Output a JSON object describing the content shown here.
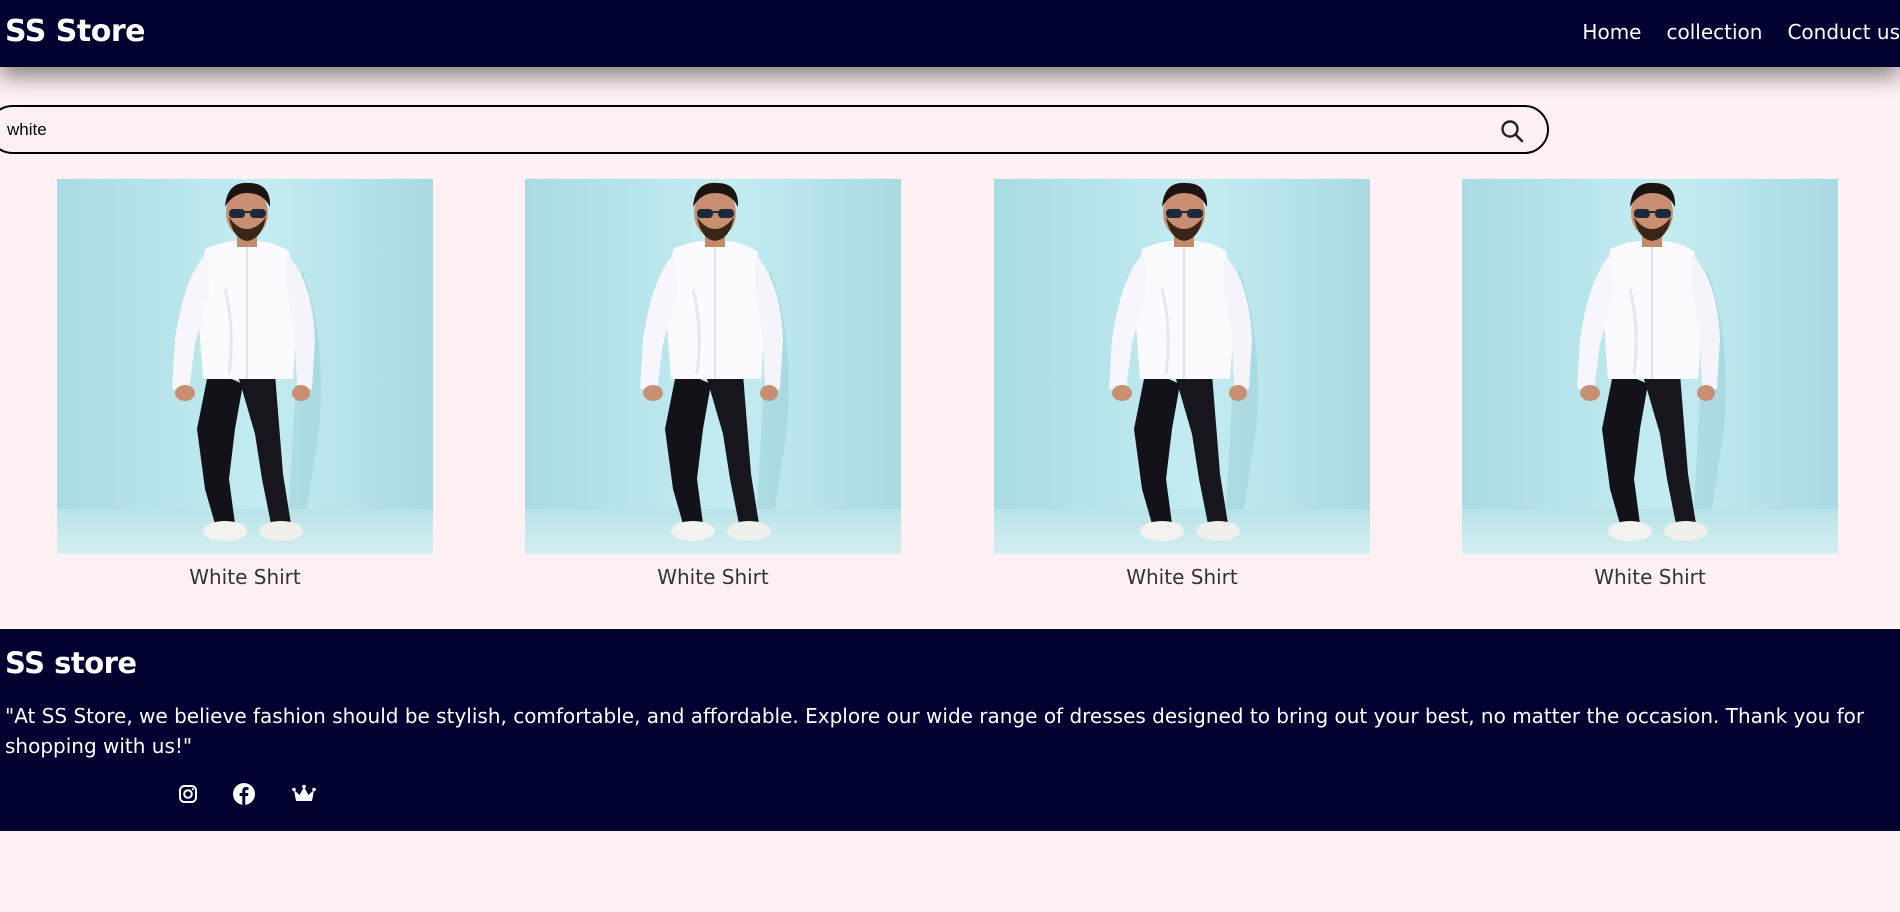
{
  "header": {
    "brand": "SS Store",
    "nav": [
      {
        "label": "Home"
      },
      {
        "label": "collection"
      },
      {
        "label": "Conduct us"
      }
    ]
  },
  "search": {
    "value": "white",
    "icon": "search-icon"
  },
  "products": [
    {
      "name": "White Shirt"
    },
    {
      "name": "White Shirt"
    },
    {
      "name": "White Shirt"
    },
    {
      "name": "White Shirt"
    }
  ],
  "footer": {
    "title": "SS store",
    "text": "\"At SS Store, we believe fashion should be stylish, comfortable, and affordable. Explore our wide range of dresses designed to bring out your best, no matter the occasion. Thank you for shopping with us!\"",
    "social": [
      {
        "icon": "instagram-icon"
      },
      {
        "icon": "facebook-icon"
      },
      {
        "icon": "crown-icon"
      }
    ]
  },
  "colors": {
    "navy": "#000031",
    "page_background": "#fff0f4",
    "product_backdrop": "#b8e6ee"
  }
}
